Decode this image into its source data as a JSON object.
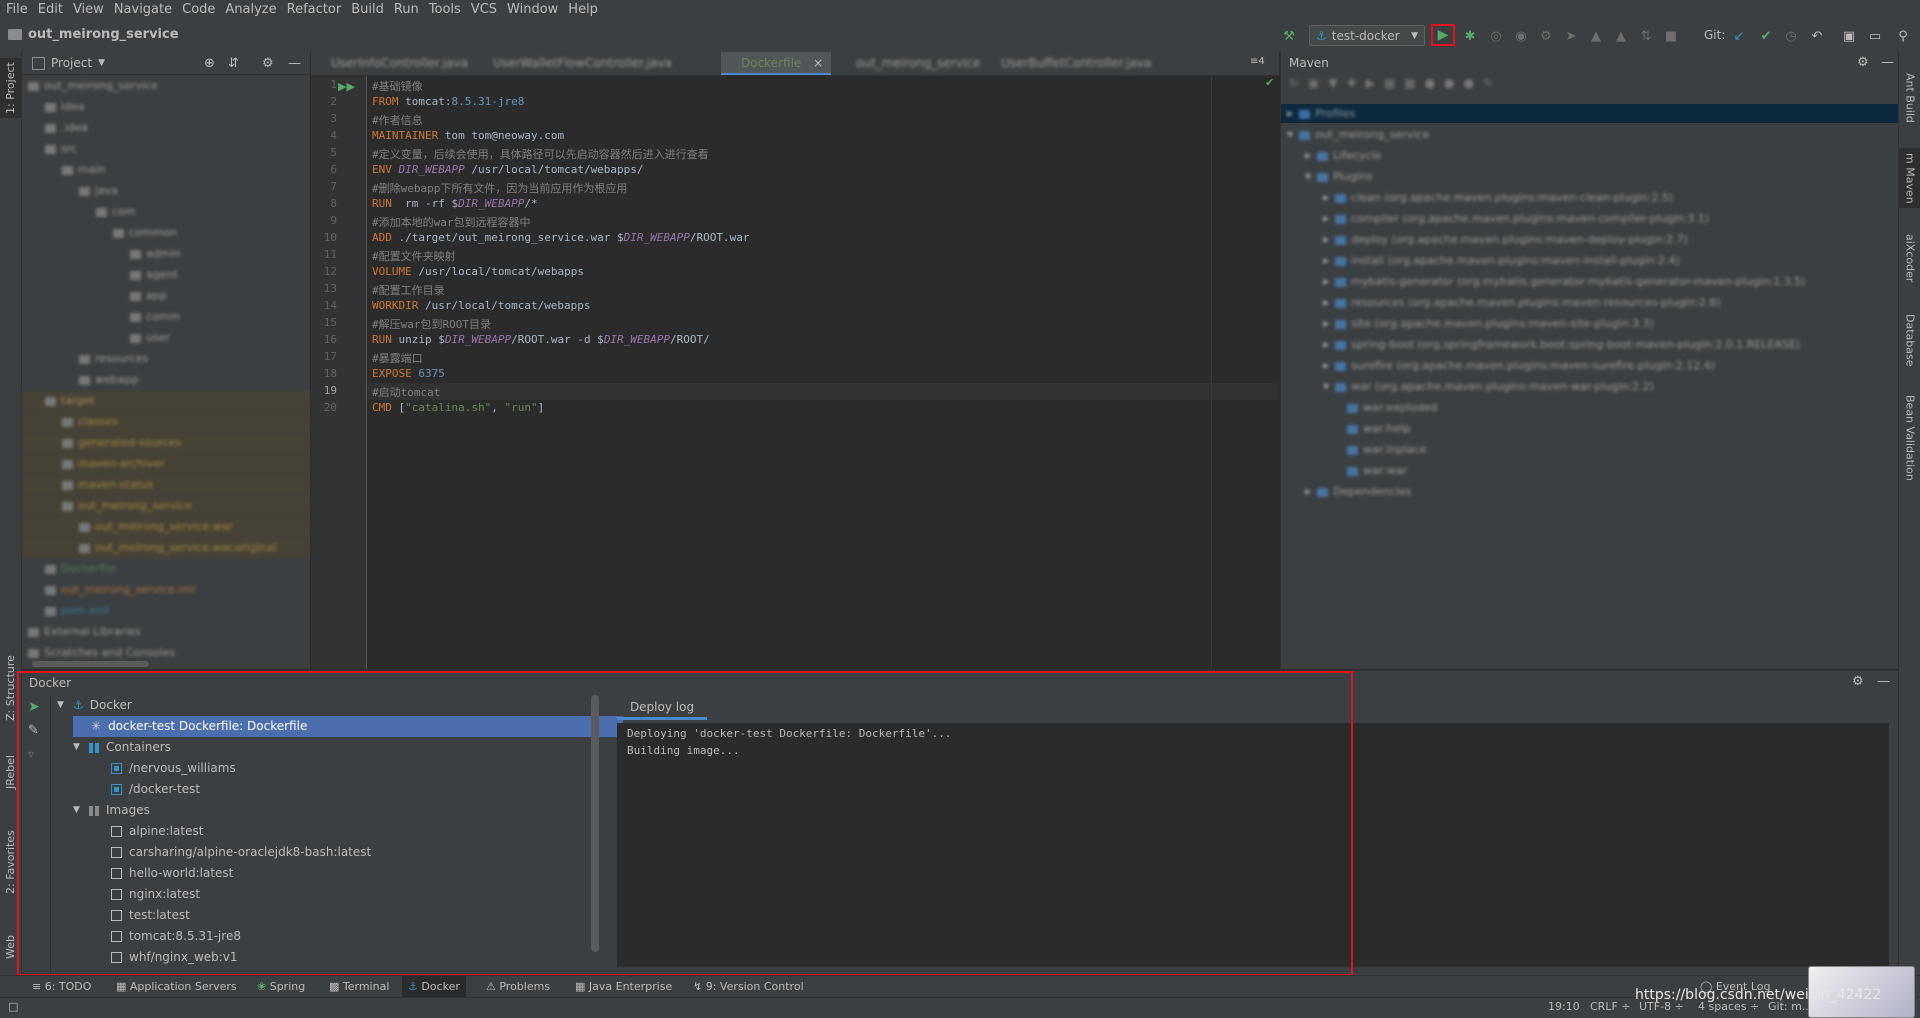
{
  "menu": [
    "File",
    "Edit",
    "View",
    "Navigate",
    "Code",
    "Analyze",
    "Refactor",
    "Build",
    "Run",
    "Tools",
    "VCS",
    "Window",
    "Help"
  ],
  "navbar": {
    "project_title": "out_meirong_service",
    "run_config": "test-docker",
    "git_label": "Git:"
  },
  "project_panel": {
    "title": "Project",
    "rows": [
      "out_meirong_service",
      "idea",
      ".idea",
      "src",
      "main",
      "java",
      "com",
      "common",
      "admin",
      "agent",
      "app",
      "comm",
      "user",
      "resources",
      "webapp",
      "target",
      "classes",
      "generated-sources",
      "maven-archiver",
      "maven-status",
      "out_meirong_service",
      "out_meirong_service.war",
      "out_meirong_service.war.original",
      "Dockerfile",
      "out_meirong_service.iml",
      "pom.xml",
      "External Libraries",
      "Scratches and Consoles"
    ]
  },
  "editor": {
    "tabs": [
      "UserInfoController.java",
      "UserWalletFlowController.java",
      "Dockerfile",
      "out_meirong_service",
      "UserBuffetController.java"
    ],
    "active_tab": "Dockerfile",
    "tab_count": "4",
    "lines": [
      {
        "n": "1",
        "parts": [
          {
            "c": "cmt",
            "t": "#基础镜像"
          }
        ]
      },
      {
        "n": "2",
        "parts": [
          {
            "c": "kw",
            "t": "FROM"
          },
          {
            "c": "",
            "t": " tomcat:"
          },
          {
            "c": "num",
            "t": "8.5.31-jre8"
          }
        ]
      },
      {
        "n": "3",
        "parts": [
          {
            "c": "cmt",
            "t": "#作者信息"
          }
        ]
      },
      {
        "n": "4",
        "parts": [
          {
            "c": "kw",
            "t": "MAINTAINER"
          },
          {
            "c": "",
            "t": " tom tom@neoway.com"
          }
        ]
      },
      {
        "n": "5",
        "parts": [
          {
            "c": "cmt",
            "t": "#定义变量，后续会使用，具体路径可以先启动容器然后进入进行查看"
          }
        ]
      },
      {
        "n": "6",
        "parts": [
          {
            "c": "kw",
            "t": "ENV"
          },
          {
            "c": "",
            "t": " "
          },
          {
            "c": "var",
            "t": "DIR_WEBAPP"
          },
          {
            "c": "",
            "t": " /usr/local/tomcat/webapps/"
          }
        ]
      },
      {
        "n": "7",
        "parts": [
          {
            "c": "cmt",
            "t": "#删除webapp下所有文件，因为当前应用作为根应用"
          }
        ]
      },
      {
        "n": "8",
        "parts": [
          {
            "c": "kw",
            "t": "RUN"
          },
          {
            "c": "",
            "t": "  rm -rf $"
          },
          {
            "c": "var",
            "t": "DIR_WEBAPP"
          },
          {
            "c": "",
            "t": "/*"
          }
        ]
      },
      {
        "n": "9",
        "parts": [
          {
            "c": "cmt",
            "t": "#添加本地的war包到远程容器中"
          }
        ]
      },
      {
        "n": "10",
        "parts": [
          {
            "c": "kw",
            "t": "ADD"
          },
          {
            "c": "",
            "t": " ./target/out_meirong_service.war $"
          },
          {
            "c": "var",
            "t": "DIR_WEBAPP"
          },
          {
            "c": "",
            "t": "/ROOT.war"
          }
        ]
      },
      {
        "n": "11",
        "parts": [
          {
            "c": "cmt",
            "t": "#配置文件夹映射"
          }
        ]
      },
      {
        "n": "12",
        "parts": [
          {
            "c": "kw",
            "t": "VOLUME"
          },
          {
            "c": "",
            "t": " /usr/local/tomcat/webapps"
          }
        ]
      },
      {
        "n": "13",
        "parts": [
          {
            "c": "cmt",
            "t": "#配置工作目录"
          }
        ]
      },
      {
        "n": "14",
        "parts": [
          {
            "c": "kw",
            "t": "WORKDIR"
          },
          {
            "c": "",
            "t": " /usr/local/tomcat/webapps"
          }
        ]
      },
      {
        "n": "15",
        "parts": [
          {
            "c": "cmt",
            "t": "#解压war包到ROOT目录"
          }
        ]
      },
      {
        "n": "16",
        "parts": [
          {
            "c": "kw",
            "t": "RUN"
          },
          {
            "c": "",
            "t": " unzip $"
          },
          {
            "c": "var",
            "t": "DIR_WEBAPP"
          },
          {
            "c": "",
            "t": "/ROOT.war -d $"
          },
          {
            "c": "var",
            "t": "DIR_WEBAPP"
          },
          {
            "c": "",
            "t": "/ROOT/"
          }
        ]
      },
      {
        "n": "17",
        "parts": [
          {
            "c": "cmt",
            "t": "#暴露端口"
          }
        ]
      },
      {
        "n": "18",
        "parts": [
          {
            "c": "kw",
            "t": "EXPOSE"
          },
          {
            "c": "",
            "t": " "
          },
          {
            "c": "num",
            "t": "6375"
          }
        ]
      },
      {
        "n": "19",
        "parts": [
          {
            "c": "cmt",
            "t": "#启动tomcat"
          }
        ]
      },
      {
        "n": "20",
        "parts": [
          {
            "c": "kw",
            "t": "CMD"
          },
          {
            "c": "",
            "t": " ["
          },
          {
            "c": "str",
            "t": "\"catalina.sh\""
          },
          {
            "c": "",
            "t": ", "
          },
          {
            "c": "str",
            "t": "\"run\""
          },
          {
            "c": "",
            "t": "]"
          }
        ]
      }
    ]
  },
  "maven": {
    "title": "Maven",
    "rows": [
      "Profiles",
      "out_meirong_service",
      "Lifecycle",
      "Plugins",
      "clean (org.apache.maven.plugins:maven-clean-plugin:2.5)",
      "compiler (org.apache.maven.plugins:maven-compiler-plugin:3.1)",
      "deploy (org.apache.maven.plugins:maven-deploy-plugin:2.7)",
      "install (org.apache.maven.plugins:maven-install-plugin:2.4)",
      "mybatis-generator (org.mybatis.generator:mybatis-generator-maven-plugin:1.3.5)",
      "resources (org.apache.maven.plugins:maven-resources-plugin:2.6)",
      "site (org.apache.maven.plugins:maven-site-plugin:3.3)",
      "spring-boot (org.springframework.boot:spring-boot-maven-plugin:2.0.1.RELEASE)",
      "surefire (org.apache.maven.plugins:maven-surefire-plugin:2.12.4)",
      "war (org.apache.maven.plugins:maven-war-plugin:2.2)",
      "war:exploded",
      "war:help",
      "war:inplace",
      "war:war",
      "Dependencies"
    ]
  },
  "right_stripe": [
    "Ant Build",
    "m Maven",
    "aiXcoder",
    "Database",
    "Bean Validation"
  ],
  "left_stripe": [
    "1: Project",
    "Z: Structure",
    "JRebel",
    "2: Favorites",
    "Web"
  ],
  "docker": {
    "title": "Docker",
    "root": "Docker",
    "selected": "docker-test Dockerfile: Dockerfile",
    "containers_label": "Containers",
    "containers": [
      "/nervous_williams",
      "/docker-test"
    ],
    "images_label": "Images",
    "images": [
      "alpine:latest",
      "carsharing/alpine-oraclejdk8-bash:latest",
      "hello-world:latest",
      "nginx:latest",
      "test:latest",
      "tomcat:8.5.31-jre8",
      "whf/nginx_web:v1"
    ],
    "deploy_tab": "Deploy log",
    "log": [
      "Deploying 'docker-test Dockerfile: Dockerfile'...",
      "Building image..."
    ]
  },
  "bottom_tabs": [
    "6: TODO",
    "Application Servers",
    "Spring",
    "Terminal",
    "Docker",
    "Problems",
    "Java Enterprise",
    "9: Version Control"
  ],
  "event_log": "Event Log",
  "status": {
    "position": "19:10",
    "line_sep": "CRLF ÷",
    "encoding": "UTF-8 ÷",
    "indent": "4 spaces ÷",
    "git": "Git: m..."
  },
  "watermark": "https://blog.csdn.net/weixin_42422"
}
